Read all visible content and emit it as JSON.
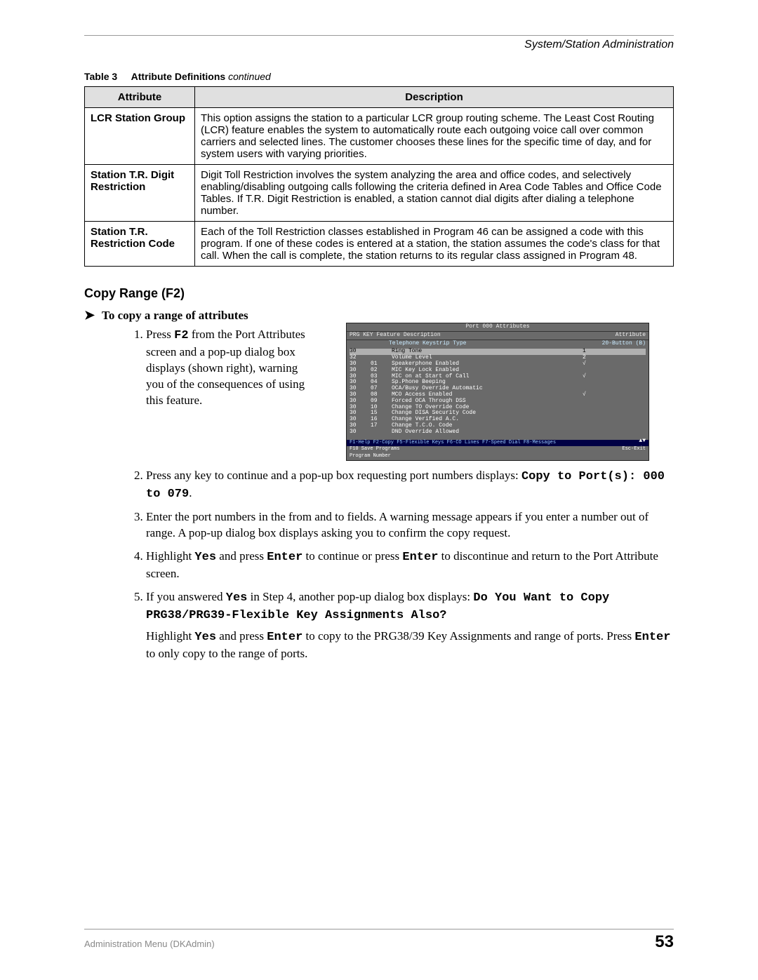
{
  "header": {
    "section": "System/Station Administration"
  },
  "table": {
    "caption_label": "Table 3",
    "caption_title": "Attribute Definitions ",
    "caption_suffix": "continued",
    "col_attr": "Attribute",
    "col_desc": "Description",
    "rows": [
      {
        "attr": "LCR Station Group",
        "desc": "This option assigns the station to a particular LCR group routing scheme. The Least Cost Routing (LCR) feature enables the system to automatically route each outgoing voice call over common carriers and selected lines. The customer chooses these lines for the specific time of day, and for system users with varying priorities."
      },
      {
        "attr": "Station T.R. Digit Restriction",
        "desc": "Digit Toll Restriction involves the system analyzing the area and office codes, and selectively enabling/disabling outgoing calls following the criteria defined in Area Code Tables and Office Code Tables. If T.R. Digit Restriction is enabled, a station cannot dial digits after dialing a telephone number."
      },
      {
        "attr": "Station T.R. Restriction Code",
        "desc": "Each of the Toll Restriction classes established in Program 46 can be assigned a code with this program. If one of these codes is entered at a station, the station assumes the code's class for that call. When the call is complete, the station returns to its regular class assigned in Program 48."
      }
    ]
  },
  "section_heading": "Copy Range (F2)",
  "proc_title": "To copy a range of attributes",
  "steps": {
    "s1_a": "Press ",
    "s1_key": "F2",
    "s1_b": " from the Port Attributes screen and a pop-up dialog box displays (shown right), warning you of the consequences of using this feature.",
    "s2_a": "Press any key to continue and a pop-up box requesting port numbers displays: ",
    "s2_code": "Copy to Port(s): 000 to 079",
    "s2_b": ".",
    "s3": "Enter the port numbers in the from and to fields. A warning message appears if you enter a number out of range. A pop-up dialog box displays asking you to confirm the copy request.",
    "s4_a": "Highlight ",
    "s4_yes": "Yes",
    "s4_b": " and press ",
    "s4_enter1": "Enter",
    "s4_c": " to continue or press ",
    "s4_enter2": "Enter",
    "s4_d": " to discontinue and return to the Port Attribute screen.",
    "s5_a": "If you answered ",
    "s5_yes": "Yes",
    "s5_b": " in Step 4, another pop-up dialog box displays: ",
    "s5_code": "Do You Want to Copy PRG38/PRG39-Flexible Key Assignments Also?",
    "s5_sub_a": "Highlight ",
    "s5_sub_yes": "Yes",
    "s5_sub_b": " and press ",
    "s5_sub_enter1": "Enter",
    "s5_sub_c": " to copy to the PRG38/39 Key Assignments and range of ports. Press ",
    "s5_sub_enter2": "Enter",
    "s5_sub_d": " to only copy to the range of ports."
  },
  "terminal": {
    "title": "Port  000 Attributes",
    "head_l": "PRG   KEY   Feature Description",
    "head_r": "Attribute",
    "sub_l": "Telephone Keystrip Type",
    "sub_r": "20-Button (B)",
    "rows": [
      {
        "p": "30",
        "k": "",
        "d": "Ring Tone",
        "v": "1"
      },
      {
        "p": "32",
        "k": "",
        "d": "Volume Level",
        "v": "2"
      },
      {
        "p": "30",
        "k": "01",
        "d": "Speakerphone Enabled",
        "v": "√"
      },
      {
        "p": "30",
        "k": "02",
        "d": "MIC Key Lock Enabled",
        "v": ""
      },
      {
        "p": "30",
        "k": "03",
        "d": "MIC on at Start of Call",
        "v": "√"
      },
      {
        "p": "30",
        "k": "04",
        "d": "Sp.Phone Beeping",
        "v": ""
      },
      {
        "p": "30",
        "k": "07",
        "d": "OCA/Busy Override Automatic",
        "v": ""
      },
      {
        "p": "30",
        "k": "08",
        "d": "MCO Access Enabled",
        "v": "√"
      },
      {
        "p": "30",
        "k": "09",
        "d": "Forced OCA Through DSS",
        "v": ""
      },
      {
        "p": "30",
        "k": "10",
        "d": "Change TO Override Code",
        "v": ""
      },
      {
        "p": "30",
        "k": "15",
        "d": "Change DISA Security Code",
        "v": ""
      },
      {
        "p": "30",
        "k": "16",
        "d": "Change Verified A.C.",
        "v": ""
      },
      {
        "p": "30",
        "k": "17",
        "d": "Change T.C.O. Code",
        "v": ""
      },
      {
        "p": "30",
        "k": "",
        "d": "DND Override Allowed",
        "v": ""
      }
    ],
    "foot1": "F1-Help  F2-Copy  F5-Flexible Keys  F6-CO Lines  F7-Speed Dial  F8-Messages",
    "foot2_l": "F10 Save Programs",
    "foot2_r": "Esc-Exit",
    "foot3": "Program Number"
  },
  "footer": {
    "left": "Administration Menu (DKAdmin)",
    "page": "53"
  }
}
